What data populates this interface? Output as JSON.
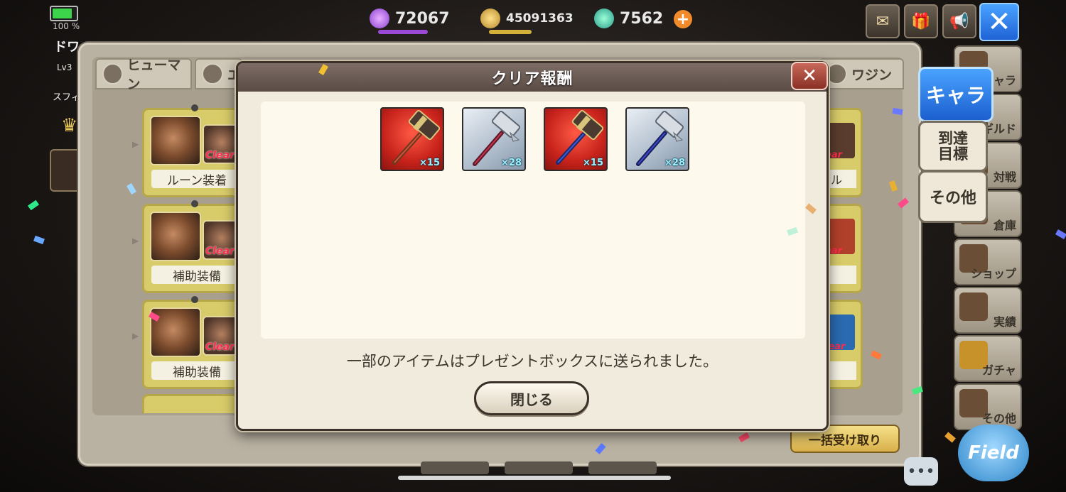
{
  "status": {
    "battery_pct": "100 %",
    "player_name": "ドワ",
    "player_level": "Lv3",
    "sub_label": "スフィ"
  },
  "resources": [
    {
      "icon": "crystal-icon",
      "value": "72067"
    },
    {
      "icon": "coin-icon",
      "value": "45091363"
    },
    {
      "icon": "gem-icon",
      "value": "7562"
    }
  ],
  "background": {
    "tabs": [
      "ヒューマン",
      "エ",
      "ワジン"
    ],
    "missions": [
      {
        "label": "ルーン装着",
        "status": "Clear"
      },
      {
        "label": "補助装備",
        "status": "Clear"
      },
      {
        "label": "補助装備",
        "status": "Clear"
      }
    ],
    "right_cards": [
      {
        "status": "ear",
        "label": "ベル"
      },
      {
        "status": "ear",
        "label": ""
      },
      {
        "status": "lear",
        "label": ""
      }
    ],
    "bulk_receive": "一括受け取り"
  },
  "side_menu": {
    "chara": "キャラ",
    "goal": "到達\n目標",
    "other": "その他",
    "items": [
      "キャラ",
      "ギルド",
      "対戦",
      "倉庫",
      "ショップ",
      "実績",
      "ガチャ",
      "その他"
    ],
    "field": "Field"
  },
  "modal": {
    "title": "クリア報酬",
    "items": [
      {
        "type": "hammer-red",
        "quantity": "×15"
      },
      {
        "type": "hammer-silver",
        "quantity": "×28"
      },
      {
        "type": "hammer-red",
        "quantity": "×15"
      },
      {
        "type": "hammer-silver",
        "quantity": "×28"
      }
    ],
    "notice": "一部のアイテムはプレゼントボックスに送られました。",
    "close_label": "閉じる"
  },
  "colors": {
    "accent_blue": "#2f7fe6",
    "modal_header": "#6a5a54",
    "clear_red": "#ff2d4a"
  }
}
